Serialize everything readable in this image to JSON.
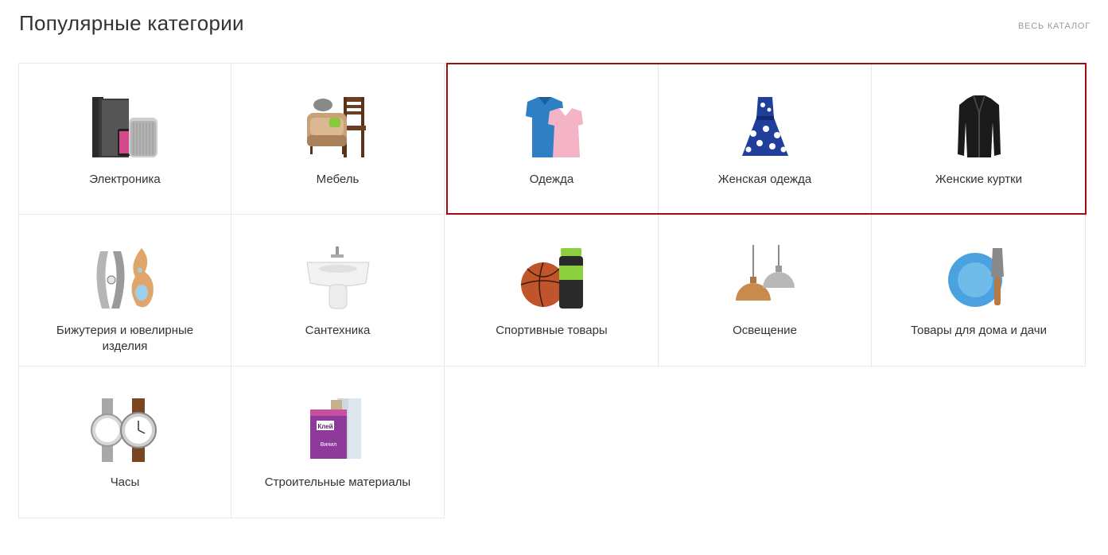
{
  "header": {
    "title": "Популярные категории",
    "catalog_link": "ВЕСЬ КАТАЛОГ"
  },
  "colors": {
    "highlight": "#a00d12",
    "border": "#e8e8e8",
    "text": "#333333"
  },
  "categories": [
    {
      "label": "Электроника",
      "icon": "electronics-icon"
    },
    {
      "label": "Мебель",
      "icon": "furniture-icon"
    },
    {
      "label": "Одежда",
      "icon": "clothing-icon"
    },
    {
      "label": "Женская одежда",
      "icon": "dress-icon"
    },
    {
      "label": "Женские куртки",
      "icon": "jacket-icon"
    },
    {
      "label": "Бижутерия и ювелирные изделия",
      "icon": "jewelry-icon"
    },
    {
      "label": "Сантехника",
      "icon": "sink-icon"
    },
    {
      "label": "Спортивные товары",
      "icon": "sports-icon"
    },
    {
      "label": "Освещение",
      "icon": "lamp-icon"
    },
    {
      "label": "Товары для дома и дачи",
      "icon": "home-garden-icon"
    },
    {
      "label": "Часы",
      "icon": "watch-icon"
    },
    {
      "label": "Строительные материалы",
      "icon": "building-materials-icon"
    }
  ]
}
